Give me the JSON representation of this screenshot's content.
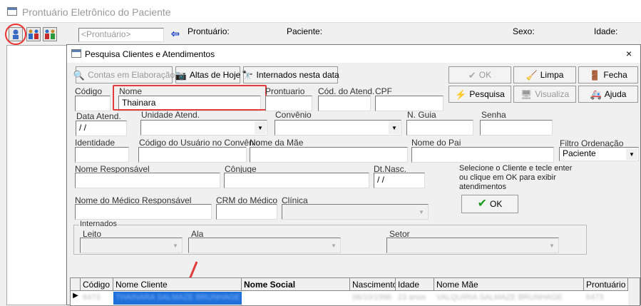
{
  "app": {
    "title": "Prontuário Eletrônico do Paciente"
  },
  "outer_toolbar": {
    "prontuario_placeholder": "<Prontuário>",
    "prontuario_label": "Prontuário:",
    "paciente_label": "Paciente:",
    "sexo_label": "Sexo:",
    "idade_label": "Idade:"
  },
  "dialog": {
    "title": "Pesquisa Clientes e Atendimentos",
    "close_glyph": "×",
    "buttons": {
      "contas": "Contas em Elaboração",
      "altas": "Altas de Hoje",
      "internados": "Internados nesta data",
      "ok": "OK",
      "limpa": "Limpa",
      "fecha": "Fecha",
      "pesquisa": "Pesquisa",
      "visualiza": "Visualiza",
      "ajuda": "Ajuda",
      "ok2": "OK"
    },
    "labels": {
      "codigo": "Código",
      "nome": "Nome",
      "prontuario": "Prontuario",
      "cod_atend": "Cód. do Atend.",
      "cpf": "CPF",
      "data_atend": "Data Atend.",
      "unidade_atend": "Unidade Atend.",
      "convenio": "Convênio",
      "n_guia": "N. Guia",
      "senha": "Senha",
      "identidade": "Identidade",
      "cod_usuario": "Código do Usuário no Convênio",
      "nome_mae": "Nome da Mãe",
      "nome_pai": "Nome do Pai",
      "filtro": "Filtro Ordenação",
      "nome_responsavel": "Nome Responsável",
      "conjuge": "Cônjuge",
      "dt_nasc": "Dt.Nasc.",
      "nome_medico": "Nome do Médico Responsável",
      "crm": "CRM do Médico",
      "clinica": "Clínica",
      "internados": "Internados",
      "leito": "Leito",
      "ala": "Ala",
      "setor": "Setor"
    },
    "values": {
      "nome": "Thainara",
      "data_atend": " / /",
      "dt_nasc": " / /",
      "filtro": "Paciente"
    },
    "hint": "Selecione o Cliente e tecle enter ou clique em OK para exibir atendimentos"
  },
  "grid": {
    "columns": [
      "Código",
      "Nome Cliente",
      "Nome Social",
      "Nascimento",
      "Idade",
      "Nome Mãe",
      "Prontuário"
    ],
    "row": [
      "6473",
      "THAINARA SALMAZE BRUNHAGE",
      "",
      "06/10/1996",
      "23 anos",
      "VALQUIRIA SALMAZE BRUNHAGE",
      "6473"
    ]
  },
  "colors": {
    "highlight_red": "#e23b3b",
    "selection_blue": "#1e6fd9"
  }
}
